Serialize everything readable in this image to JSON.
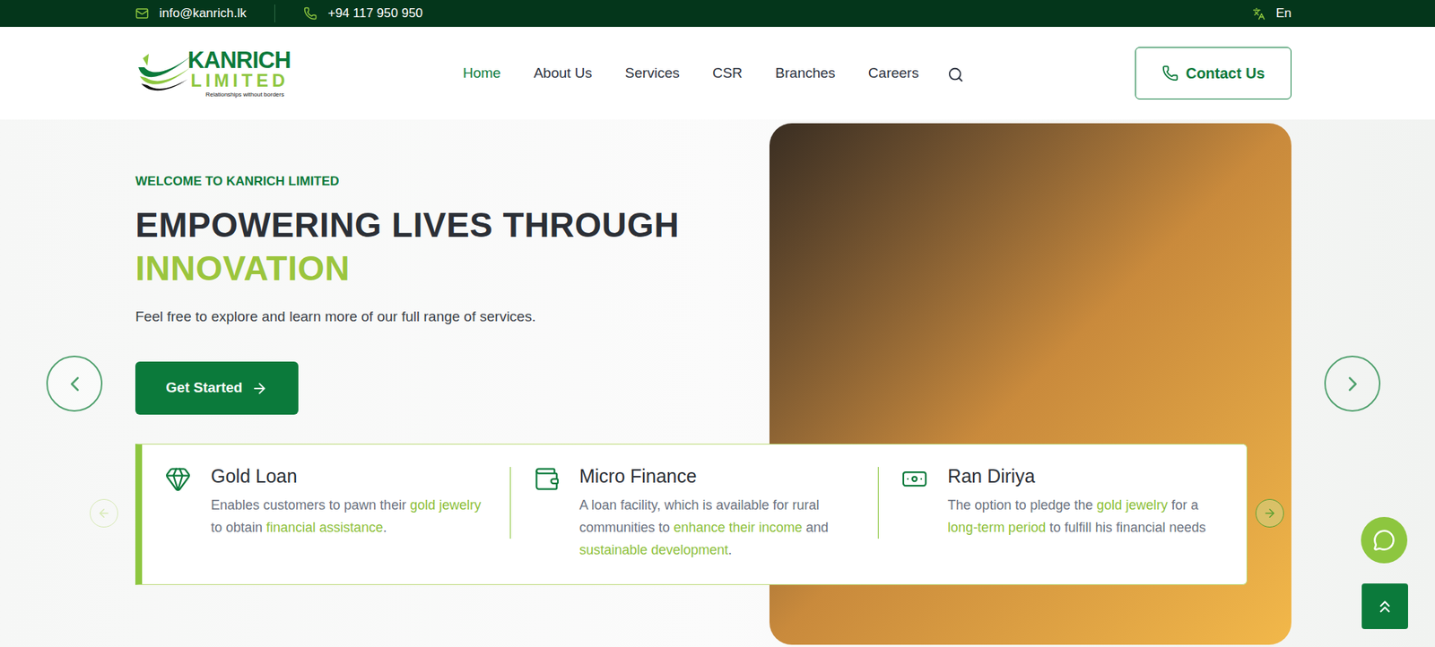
{
  "topbar": {
    "email": "info@kanrich.lk",
    "phone": "+94 117 950 950",
    "language": "En"
  },
  "logo": {
    "name": "KANRICH",
    "subtitle": "LIMITED",
    "tagline": "Relationships without borders"
  },
  "nav": [
    {
      "label": "Home",
      "selected": true
    },
    {
      "label": "About Us",
      "selected": false
    },
    {
      "label": "Services",
      "selected": false
    },
    {
      "label": "CSR",
      "selected": false
    },
    {
      "label": "Branches",
      "selected": false
    },
    {
      "label": "Careers",
      "selected": false
    }
  ],
  "contact_button": "Contact Us",
  "hero": {
    "eyebrow": "WELCOME TO KANRICH LIMITED",
    "title": "EMPOWERING LIVES THROUGH",
    "title_highlight": "INNOVATION",
    "text": "Feel free to explore and learn more of our full range of services.",
    "button": "Get Started"
  },
  "services": [
    {
      "title": "Gold Loan",
      "description": [
        {
          "text": "Enables customers to pawn their ",
          "highlight": false
        },
        {
          "text": "gold jewelry",
          "highlight": true
        },
        {
          "text": " to obtain ",
          "highlight": false
        },
        {
          "text": "financial assistance",
          "highlight": true
        },
        {
          "text": ".",
          "highlight": false
        }
      ]
    },
    {
      "title": "Micro Finance",
      "description": [
        {
          "text": "A loan facility, which is available for rural communities to ",
          "highlight": false
        },
        {
          "text": "enhance their income",
          "highlight": true
        },
        {
          "text": " and ",
          "highlight": false
        },
        {
          "text": "sustainable development",
          "highlight": true
        },
        {
          "text": ".",
          "highlight": false
        }
      ]
    },
    {
      "title": "Ran Diriya",
      "description": [
        {
          "text": "The option to pledge the ",
          "highlight": false
        },
        {
          "text": "gold jewelry",
          "highlight": true
        },
        {
          "text": " for a ",
          "highlight": false
        },
        {
          "text": "long-term period",
          "highlight": true
        },
        {
          "text": " to fulfill his financial needs",
          "highlight": false
        }
      ]
    }
  ]
}
